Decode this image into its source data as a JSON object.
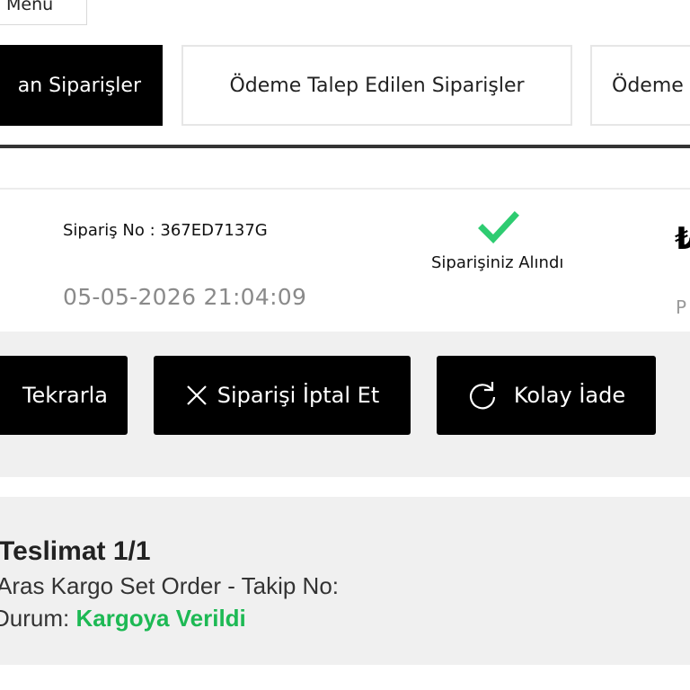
{
  "top_menu": {
    "label": "Menü"
  },
  "tabs": [
    {
      "label": "Tüm Siparişler",
      "visible_text": "an Siparişler",
      "active": true
    },
    {
      "label": "Ödeme Talep Edilen Siparişler",
      "active": false
    },
    {
      "label": "Ödeme",
      "active": false
    }
  ],
  "order": {
    "number_text": "Sipariş No : 367ED7137G",
    "date": "05-05-2026 21:04:09",
    "status_text": "Siparişiniz Alındı",
    "currency_symbol": "₺",
    "price_partial": "P"
  },
  "actions": {
    "repeat_label": "Tekrarla",
    "cancel_label": "Siparişi İptal Et",
    "return_label": "Kolay İade"
  },
  "delivery": {
    "title": "Teslimat 1/1",
    "cargo_line": "Aras Kargo Set Order - Takip No:",
    "status_label": "Durum: ",
    "status_value": "Kargoya Verildi"
  },
  "colors": {
    "accent_green": "#1db954",
    "check_green": "#2ecc71",
    "button_black": "#000000"
  }
}
